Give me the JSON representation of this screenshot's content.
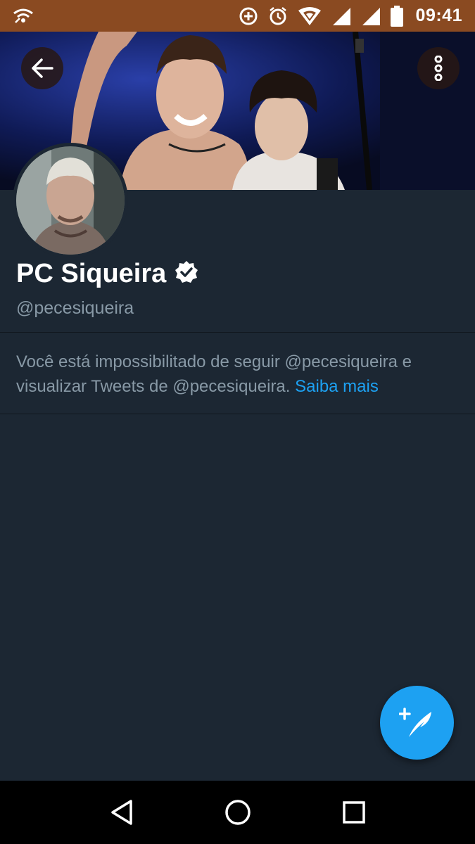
{
  "status_bar": {
    "time": "09:41",
    "bg_color": "#8a4a21",
    "icons": [
      "wifi-calling-icon",
      "data-saver-icon",
      "alarm-icon",
      "wifi-icon",
      "signal-icon",
      "signal-icon",
      "battery-icon"
    ]
  },
  "header": {
    "back_icon": "arrow-left-icon",
    "more_icon": "more-vertical-icon"
  },
  "profile": {
    "display_name": "PC Siqueira",
    "verified": true,
    "handle": "@pecesiqueira"
  },
  "notice": {
    "text": "Você está impossibilitado de seguir @pecesiqueira e visualizar Tweets de @pecesiqueira.",
    "link_text": "Saiba mais",
    "link_color": "#1da1f2"
  },
  "fab": {
    "icon": "compose-tweet-icon",
    "color": "#1da1f2"
  },
  "nav_bar": {
    "items": [
      "back-triangle-icon",
      "home-circle-icon",
      "recents-square-icon"
    ]
  },
  "theme": {
    "background": "#1c2733",
    "text_primary": "#ffffff",
    "text_secondary": "#8899a6"
  }
}
